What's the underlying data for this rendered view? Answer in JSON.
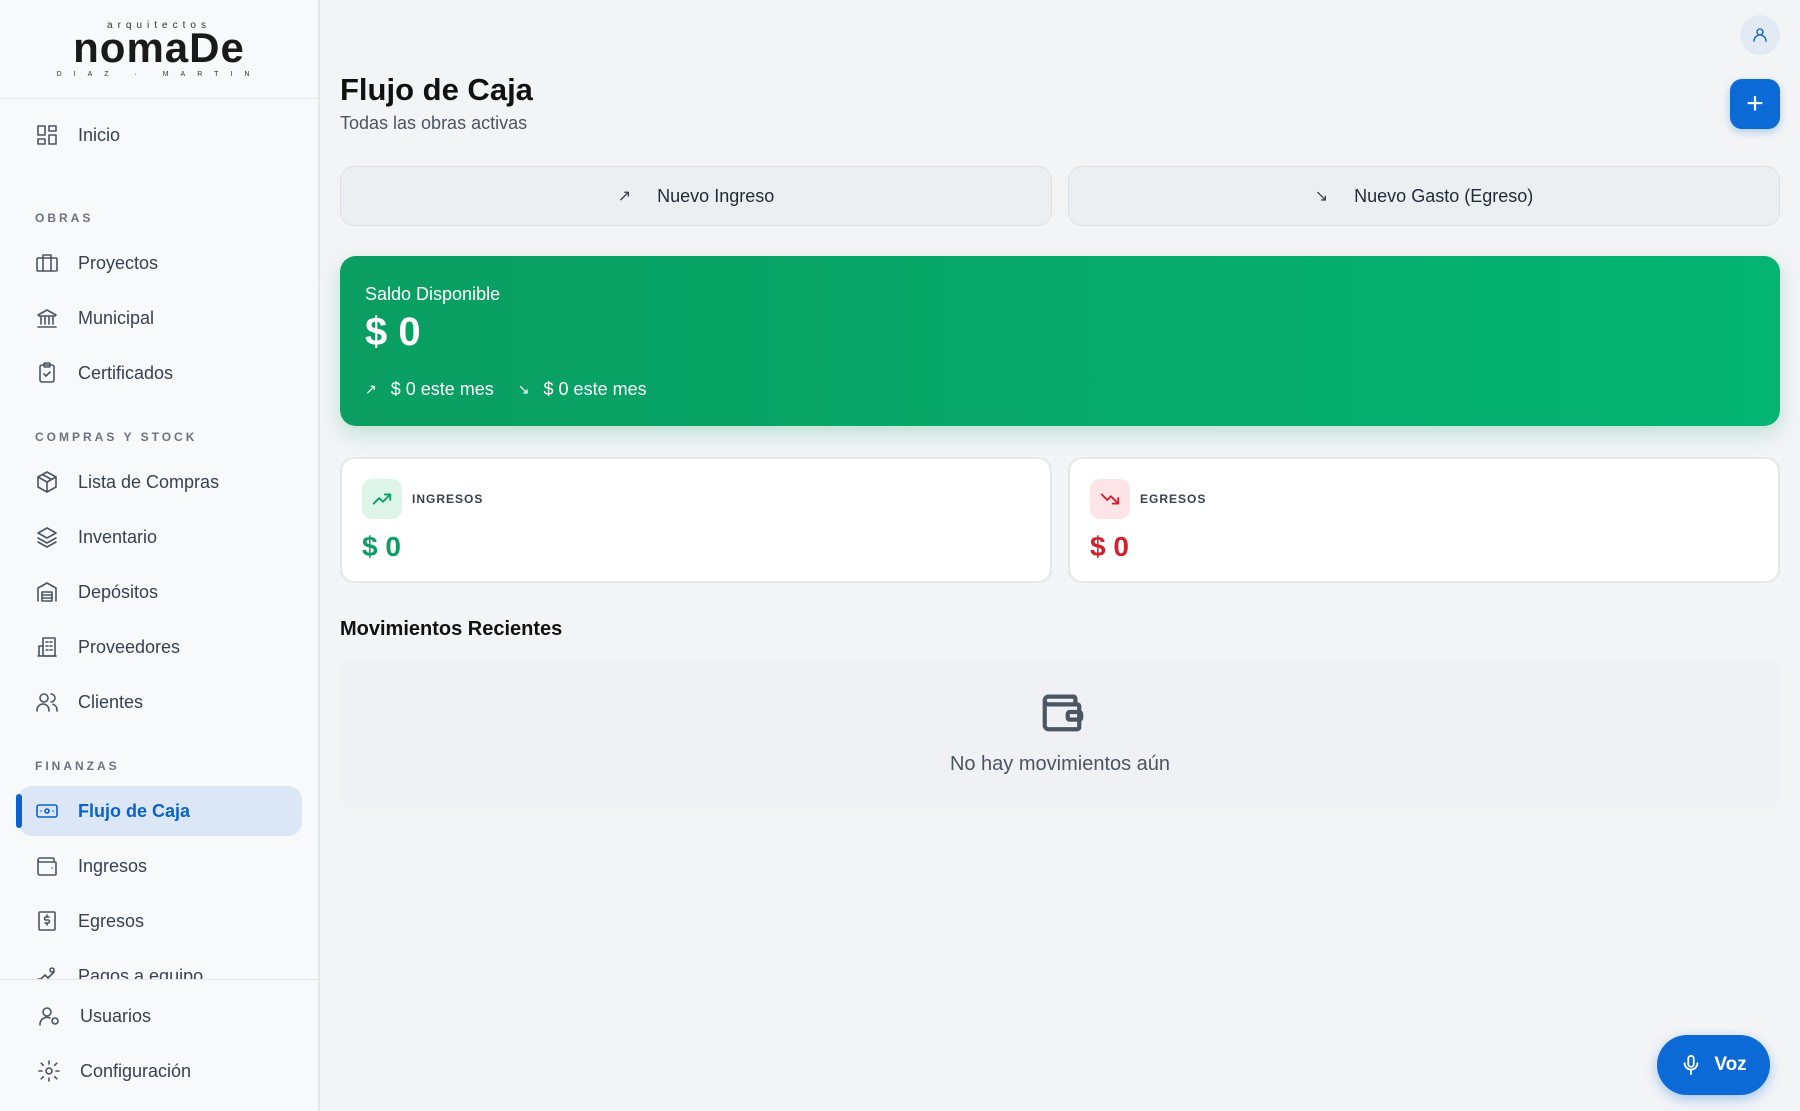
{
  "brand": {
    "top": "arquitectos",
    "main": "nomaDe",
    "bottom": "DIAZ · MARTIN"
  },
  "sidebar": {
    "inicio": "Inicio",
    "sections": {
      "obras": "OBRAS",
      "compras": "COMPRAS Y STOCK",
      "finanzas": "FINANZAS"
    },
    "items": [
      {
        "label": "Proyectos",
        "icon": "briefcase-icon"
      },
      {
        "label": "Municipal",
        "icon": "bank-icon"
      },
      {
        "label": "Certificados",
        "icon": "clipboard-check-icon"
      },
      {
        "label": "Lista de Compras",
        "icon": "package-icon"
      },
      {
        "label": "Inventario",
        "icon": "layers-icon"
      },
      {
        "label": "Depósitos",
        "icon": "warehouse-icon"
      },
      {
        "label": "Proveedores",
        "icon": "building-icon"
      },
      {
        "label": "Clientes",
        "icon": "users-icon"
      },
      {
        "label": "Flujo de Caja",
        "icon": "banknote-icon",
        "active": true
      },
      {
        "label": "Ingresos",
        "icon": "wallet-icon"
      },
      {
        "label": "Egresos",
        "icon": "receipt-icon"
      },
      {
        "label": "Pagos a equipo",
        "icon": "hand-coins-icon"
      }
    ],
    "bottom": {
      "usuarios": "Usuarios",
      "configuracion": "Configuración"
    }
  },
  "header": {
    "title": "Flujo de Caja",
    "subtitle": "Todas las obras activas",
    "add_label": "+"
  },
  "actions": {
    "ingreso": "Nuevo Ingreso",
    "gasto": "Nuevo Gasto (Egreso)",
    "arrow_up": "↗",
    "arrow_down": "↘"
  },
  "balance": {
    "label": "Saldo Disponible",
    "value": "$ 0",
    "in_month": "$ 0 este mes",
    "out_month": "$ 0 este mes"
  },
  "cards": {
    "ingresos": {
      "label": "INGRESOS",
      "value": "$ 0",
      "color": "#0a9e62"
    },
    "egresos": {
      "label": "EGRESOS",
      "value": "$ 0",
      "color": "#d61f2c"
    }
  },
  "movimientos": {
    "title": "Movimientos Recientes",
    "empty": "No hay movimientos aún"
  },
  "voice": {
    "label": "Voz"
  },
  "colors": {
    "primary": "#0b6ad6",
    "success": "#0a9e62",
    "danger": "#d61f2c"
  }
}
